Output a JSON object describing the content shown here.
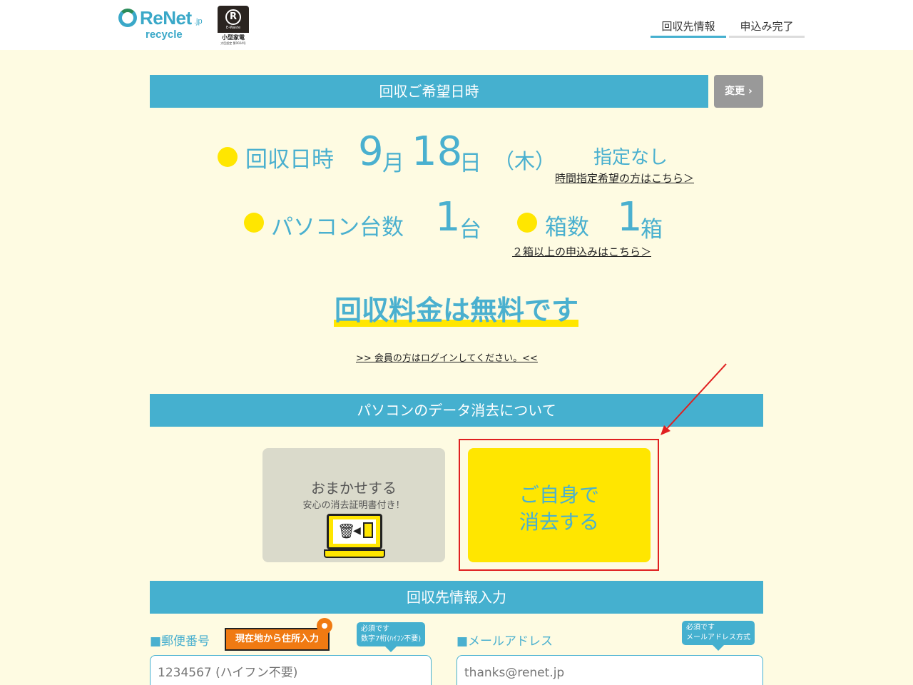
{
  "header": {
    "logo": {
      "name": "ReNet",
      "suffix": ".jp",
      "sub": "recycle"
    },
    "badge": {
      "mark": "R",
      "label": "小型家電",
      "ew": "E-Waste",
      "note": "大臣認定 第0024号"
    },
    "nav": [
      {
        "label": "回収先情報",
        "active": true
      },
      {
        "label": "申込み完了",
        "active": false
      }
    ]
  },
  "schedule": {
    "title": "回収ご希望日時",
    "change_label": "変更",
    "date_label": "回収日時",
    "month": "9",
    "month_unit": "月",
    "day": "18",
    "day_unit": "日",
    "weekday": "（木）",
    "time_value": "指定なし",
    "time_link": "時間指定希望の方はこちら＞",
    "pc_label": "パソコン台数",
    "pc_count": "1",
    "pc_unit": "台",
    "box_label": "箱数",
    "box_count": "1",
    "box_unit": "箱",
    "box_link": "２箱以上の申込みはこちら＞",
    "fee_text": "回収料金は無料です",
    "login_link": ">> 会員の方はログインしてください。<<"
  },
  "erase": {
    "title": "パソコンのデータ消去について",
    "option1_title": "おまかせする",
    "option1_sub": "安心の消去証明書付き！",
    "option2_line1": "ご自身で",
    "option2_line2": "消去する"
  },
  "form": {
    "title": "回収先情報入力",
    "postal_label": "■郵便番号",
    "location_button": "現在地から住所入力",
    "postal_tip_line1": "必須です",
    "postal_tip_line2": "数字7桁(ﾊｲﾌﾝ不要)",
    "postal_placeholder": "1234567 (ハイフン不要)",
    "email_label": "■メールアドレス",
    "email_tip_line1": "必須です",
    "email_tip_line2": "メールアドレス方式",
    "email_placeholder": "thanks@renet.jp"
  },
  "colors": {
    "accent": "#45b0cf",
    "highlight": "#ffe600",
    "background": "#fefbe2",
    "orange": "#f07a12",
    "annotation": "#e02020"
  }
}
